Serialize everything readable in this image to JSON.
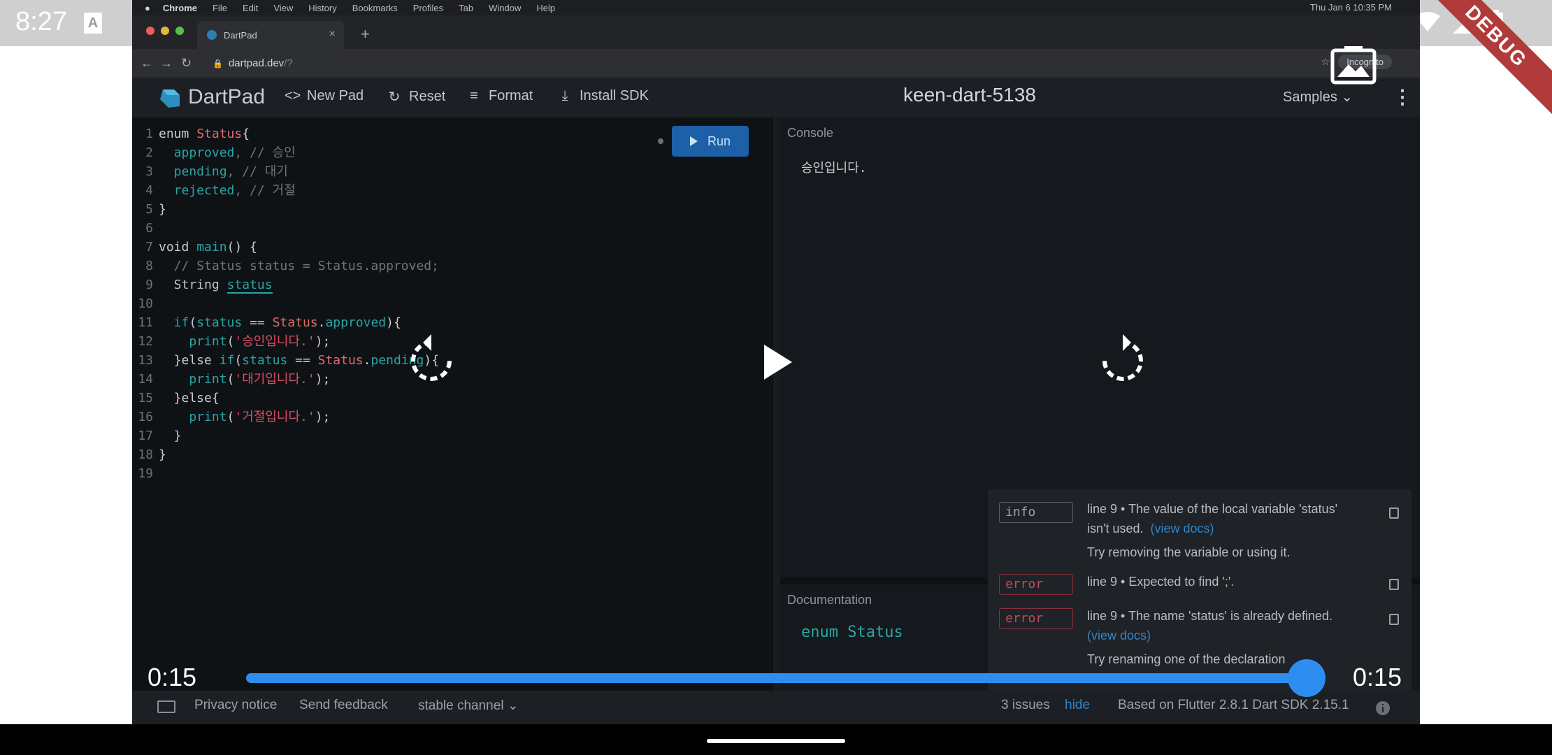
{
  "status_bar": {
    "time": "8:27",
    "a_icon": "A",
    "debug": "DEBUG"
  },
  "mac_menu": {
    "app": "Chrome",
    "items": [
      "File",
      "Edit",
      "View",
      "History",
      "Bookmarks",
      "Profiles",
      "Tab",
      "Window",
      "Help"
    ],
    "clock": "Thu Jan 6  10:35 PM"
  },
  "browser": {
    "tab_title": "DartPad",
    "url_host": "dartpad.dev",
    "url_path": "/?",
    "incognito_label": "Incognito"
  },
  "dartpad": {
    "brand": "DartPad",
    "actions": {
      "new_pad": "New Pad",
      "reset": "Reset",
      "format": "Format",
      "install_sdk": "Install SDK"
    },
    "pad_name": "keen-dart-5138",
    "samples": "Samples",
    "run": "Run",
    "console_label": "Console",
    "console_output": "승인입니다.",
    "docs_label": "Documentation",
    "docs_signature": "enum Status",
    "issues": [
      {
        "kind": "info",
        "line1": "line 9 • The value of the local variable 'status'",
        "line2": "isn't used.",
        "link": "(view docs)",
        "hint": "Try removing the variable or using it."
      },
      {
        "kind": "error",
        "line1": "line 9 • Expected to find ';'."
      },
      {
        "kind": "error",
        "line1": "line 9 • The name 'status' is already defined.",
        "link": "(view docs)",
        "hint": "Try renaming one of the declaration"
      }
    ],
    "footer": {
      "privacy": "Privacy notice",
      "feedback": "Send feedback",
      "channel": "stable channel",
      "issues_count": "3 issues",
      "hide": "hide",
      "version": "Based on Flutter 2.8.1 Dart SDK 2.15.1"
    }
  },
  "code_lines": [
    {
      "n": "1"
    },
    {
      "n": "2"
    },
    {
      "n": "3"
    },
    {
      "n": "4"
    },
    {
      "n": "5"
    },
    {
      "n": "6"
    },
    {
      "n": "7"
    },
    {
      "n": "8"
    },
    {
      "n": "9"
    },
    {
      "n": "10"
    },
    {
      "n": "11"
    },
    {
      "n": "12"
    },
    {
      "n": "13"
    },
    {
      "n": "14"
    },
    {
      "n": "15"
    },
    {
      "n": "16"
    },
    {
      "n": "17"
    },
    {
      "n": "18"
    },
    {
      "n": "19"
    }
  ],
  "code": {
    "l1a": "enum ",
    "l1b": "Status",
    "l1c": "{",
    "l2a": "  approved",
    "l2b": ", // 승인",
    "l3a": "  pending",
    "l3b": ", // 대기",
    "l4a": "  rejected",
    "l4b": ", // 거절",
    "l5": "}",
    "l7a": "void ",
    "l7b": "main",
    "l7c": "() {",
    "l8": "  // Status status = Status.approved;",
    "l9a": "  String ",
    "l9b": "status",
    "l11a": "  if",
    "l11b": "(",
    "l11c": "status",
    "l11d": " == ",
    "l11e": "Status",
    "l11f": ".",
    "l11g": "approved",
    "l11h": "){",
    "l12a": "    print",
    "l12b": "(",
    "l12c": "'승인입니다.'",
    "l12d": ");",
    "l13a": "  }else ",
    "l13b": "if",
    "l13c": "(",
    "l13d": "status",
    "l13e": " == ",
    "l13f": "Status",
    "l13g": ".",
    "l13h": "pending",
    "l13i": "){",
    "l14a": "    print",
    "l14b": "(",
    "l14c": "'대기입니다.'",
    "l14d": ");",
    "l15": "  }else{",
    "l16a": "    print",
    "l16b": "(",
    "l16c": "'거절입니다.'",
    "l16d": ");",
    "l17": "  }",
    "l18": "}"
  },
  "video": {
    "position": "0:15",
    "duration": "0:15",
    "progress": 1.0
  },
  "colors": {
    "accent": "#2d8ef0",
    "run": "#1c60a8",
    "identifier": "#2aa5a5",
    "type": "#e06c6c",
    "string": "#d94f66"
  },
  "icons": [
    "replay-icon",
    "play-icon",
    "forward-icon",
    "gallery-icon",
    "wifi-icon",
    "signal-icon",
    "battery-icon"
  ]
}
